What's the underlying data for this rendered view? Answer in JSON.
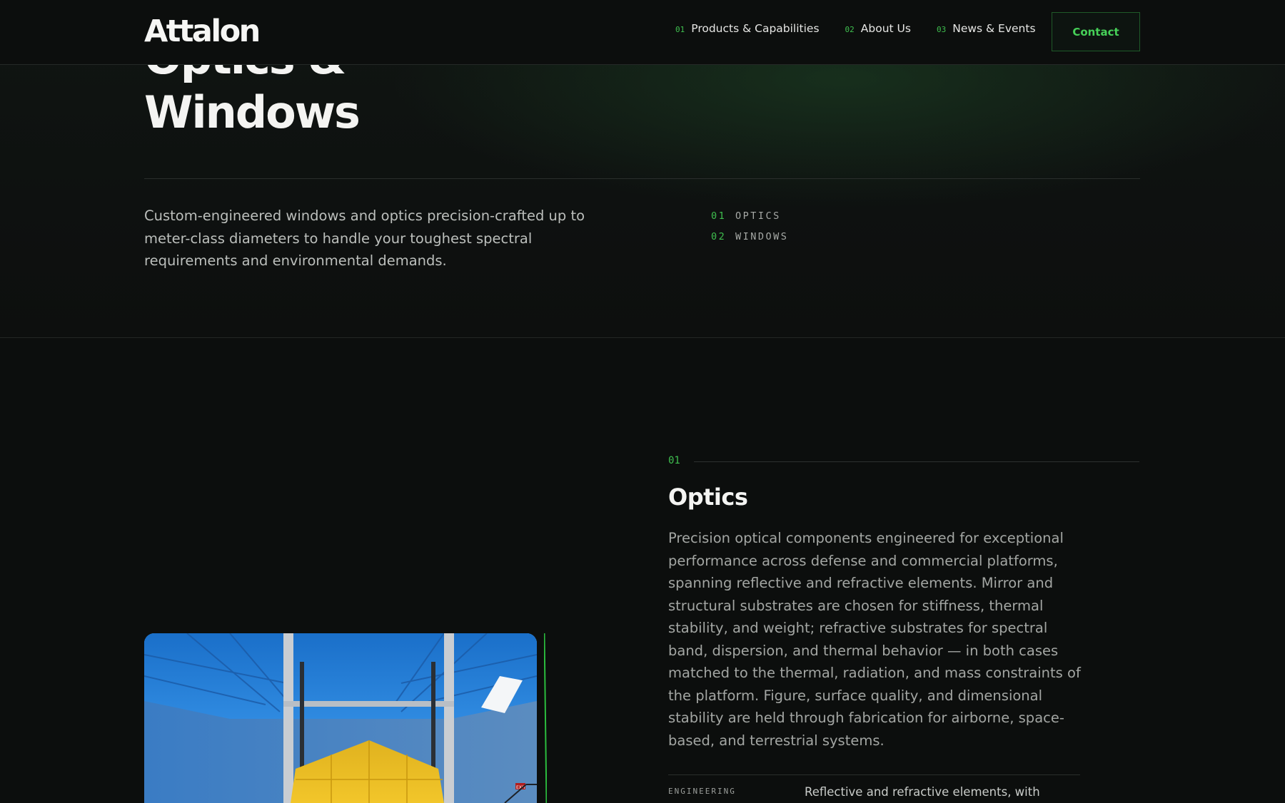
{
  "brand": {
    "logo": "Attalon",
    "accent_color": "#3fbf4f",
    "background": "#0c0e0d"
  },
  "nav": {
    "links": [
      {
        "num": "01",
        "label": "Products & Capabilities"
      },
      {
        "num": "02",
        "label": "About Us"
      },
      {
        "num": "03",
        "label": "News & Events"
      }
    ],
    "contact_label": "Contact"
  },
  "hero": {
    "title_line1": "Optics &",
    "title_line2": "Windows",
    "intro": "Custom-engineered windows and optics precision-crafted up to meter-class diameters to handle your toughest spectral requirements and environmental demands.",
    "toc": [
      {
        "num": "01",
        "label": "OPTICS"
      },
      {
        "num": "02",
        "label": "WINDOWS"
      }
    ]
  },
  "section": {
    "num": "01",
    "title": "Optics",
    "body": "Precision optical components engineered for exceptional performance across defense and commercial platforms, spanning reflective and refractive elements. Mirror and structural substrates are chosen for stiffness, thermal stability, and weight; refractive substrates for spectral band, dispersion, and thermal behavior — in both cases matched to the thermal, radiation, and mass constraints of the platform. Figure, surface quality, and dimensional stability are held through fabrication for airborne, space-based, and terrestrial systems.",
    "spec_label": "ENGINEERING",
    "spec_text": "Reflective and refractive elements, with",
    "image": {
      "exit_sign": "EXIT"
    }
  }
}
